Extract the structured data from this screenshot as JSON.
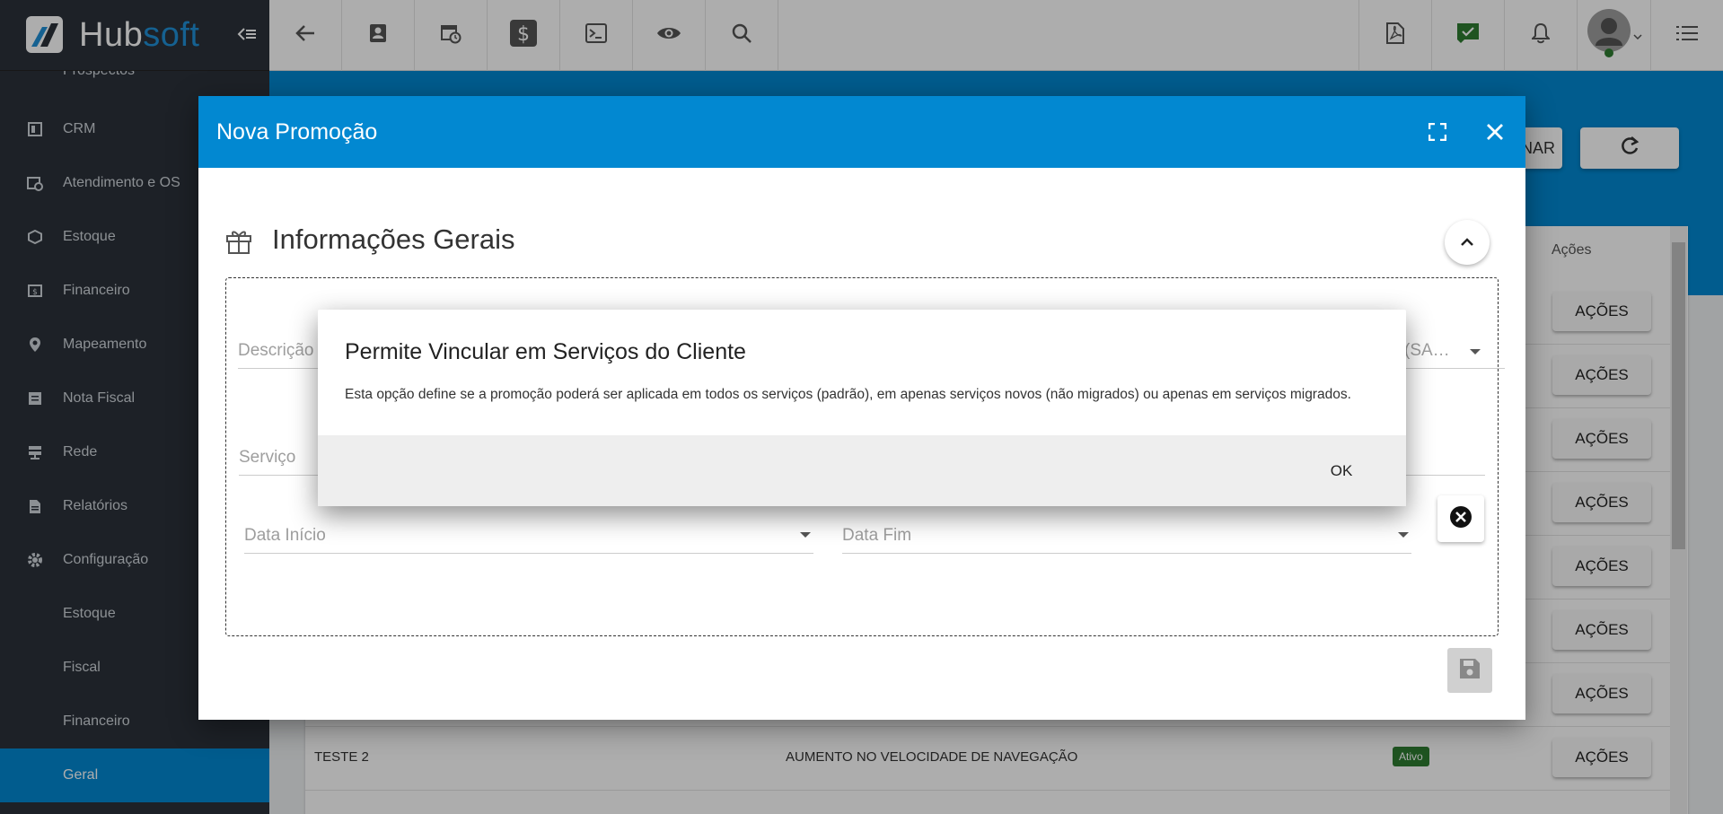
{
  "app": {
    "logo_part1": "Hub",
    "logo_part2": "soft"
  },
  "sidebar": {
    "items": [
      {
        "label": "Prospectos",
        "icon": "none"
      },
      {
        "label": "CRM",
        "icon": "board-icon"
      },
      {
        "label": "Atendimento e OS",
        "icon": "calendar-clock-icon"
      },
      {
        "label": "Estoque",
        "icon": "box-icon"
      },
      {
        "label": "Financeiro",
        "icon": "money-icon"
      },
      {
        "label": "Mapeamento",
        "icon": "map-pin-icon"
      },
      {
        "label": "Nota Fiscal",
        "icon": "invoice-icon"
      },
      {
        "label": "Rede",
        "icon": "network-icon"
      },
      {
        "label": "Relatórios",
        "icon": "report-icon"
      },
      {
        "label": "Configuração",
        "icon": "gear-icon"
      },
      {
        "label": "Estoque",
        "icon": "none"
      },
      {
        "label": "Fiscal",
        "icon": "none"
      },
      {
        "label": "Financeiro",
        "icon": "none"
      },
      {
        "label": "Geral",
        "icon": "none"
      }
    ]
  },
  "page": {
    "btn_partial": "NAR",
    "col_actions": "Ações",
    "action_label": "AÇÕES",
    "last_row": {
      "name": "TESTE 2",
      "description": "AUMENTO NO VELOCIDADE DE NAVEGAÇÃO",
      "status": "Ativo"
    }
  },
  "modal": {
    "title": "Nova Promoção",
    "section_title": "Informações Gerais",
    "fields": {
      "descricao": "Descrição",
      "partial_select": "(SA…",
      "servico": "Serviço",
      "data_inicio": "Data Início",
      "data_fim": "Data Fim"
    }
  },
  "dialog": {
    "title": "Permite Vincular em Serviços do Cliente",
    "text": "Esta opção define se a promoção poderá ser aplicada em todos os serviços (padrão), em apenas serviços novos (não migrados) ou apenas em serviços migrados.",
    "ok_label": "OK"
  },
  "colors": {
    "primary": "#0288d1",
    "sidebar": "#2b323a",
    "active_status": "#2e7d32"
  }
}
